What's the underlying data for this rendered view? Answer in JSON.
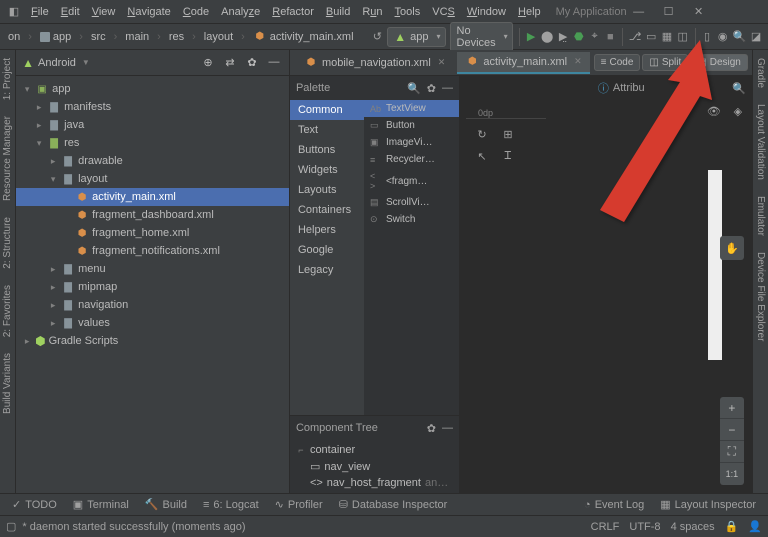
{
  "title": "My Application",
  "menu": [
    "File",
    "Edit",
    "View",
    "Navigate",
    "Code",
    "Analyze",
    "Refactor",
    "Build",
    "Run",
    "Tools",
    "VCS",
    "Window",
    "Help"
  ],
  "breadcrumb": [
    "on",
    "app",
    "src",
    "main",
    "res",
    "layout",
    "activity_main.xml"
  ],
  "run_config": "app",
  "device": "No Devices",
  "project_head": "Android",
  "tree": {
    "root": "app",
    "manifests": "manifests",
    "java": "java",
    "res": "res",
    "drawable": "drawable",
    "layout": "layout",
    "layout_files": [
      "activity_main.xml",
      "fragment_dashboard.xml",
      "fragment_home.xml",
      "fragment_notifications.xml"
    ],
    "menu_dir": "menu",
    "mipmap": "mipmap",
    "navigation": "navigation",
    "values": "values",
    "gradle": "Gradle Scripts"
  },
  "editor_tabs": [
    "mobile_navigation.xml",
    "activity_main.xml"
  ],
  "view_modes": {
    "code": "Code",
    "split": "Split",
    "design": "Design"
  },
  "palette": {
    "title": "Palette",
    "cats": [
      "Common",
      "Text",
      "Buttons",
      "Widgets",
      "Layouts",
      "Containers",
      "Helpers",
      "Google",
      "Legacy"
    ],
    "items": [
      {
        "i": "Ab",
        "t": "TextView"
      },
      {
        "i": "▭",
        "t": "Button"
      },
      {
        "i": "▣",
        "t": "ImageVi…"
      },
      {
        "i": "≡",
        "t": "Recycler…"
      },
      {
        "i": "< >",
        "t": "<fragm…"
      },
      {
        "i": "▤",
        "t": "ScrollVi…"
      },
      {
        "i": "⊙",
        "t": "Switch"
      }
    ]
  },
  "component_tree": {
    "title": "Component Tree",
    "root": "container",
    "nav": "nav_view",
    "host": "nav_host_fragment",
    "host_dim": "an…"
  },
  "attrs_title": "Attribu",
  "ruler": "0dp",
  "zoom": {
    "plus": "+",
    "minus": "−",
    "fit": "1:1"
  },
  "bottom": {
    "todo": "TODO",
    "terminal": "Terminal",
    "build": "Build",
    "logcat": "6: Logcat",
    "profiler": "Profiler",
    "db": "Database Inspector",
    "event": "Event Log",
    "layout": "Layout Inspector"
  },
  "status": {
    "msg": "* daemon started successfully (moments ago)",
    "crlf": "CRLF",
    "enc": "UTF-8",
    "spaces": "4 spaces"
  },
  "left_rail": [
    "1: Project",
    "Resource Manager",
    "2: Structure",
    "2: Favorites",
    "Build Variants"
  ],
  "right_rail": [
    "Gradle",
    "Layout Validation",
    "Emulator",
    "Device File Explorer"
  ]
}
